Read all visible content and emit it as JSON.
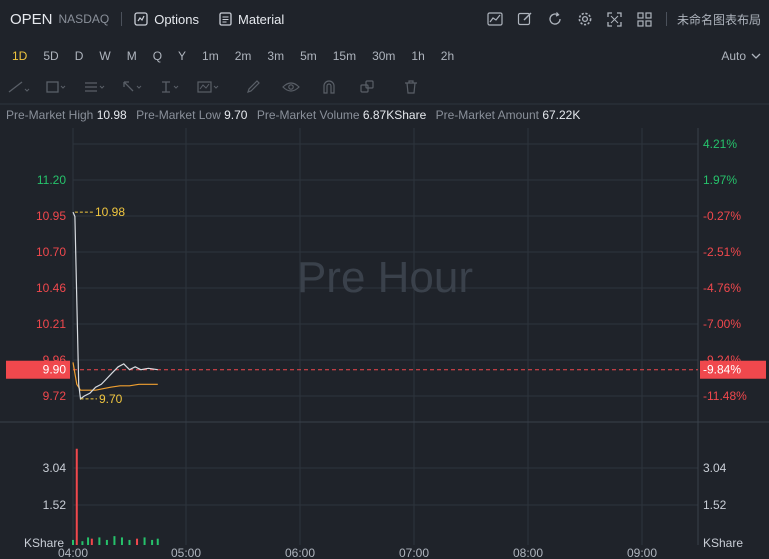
{
  "header": {
    "symbol": "OPEN",
    "exchange": "NASDAQ",
    "options_label": "Options",
    "material_label": "Material",
    "layout_name": "未命名图表布局"
  },
  "intervals": {
    "items": [
      "1D",
      "5D",
      "D",
      "W",
      "M",
      "Q",
      "Y",
      "1m",
      "2m",
      "3m",
      "5m",
      "15m",
      "30m",
      "1h",
      "2h"
    ],
    "active": "1D",
    "scale_mode": "Auto"
  },
  "info": {
    "high_label": "Pre-Market High",
    "high_value": "10.98",
    "low_label": "Pre-Market Low",
    "low_value": "9.70",
    "volume_label": "Pre-Market Volume",
    "volume_value": "6.87KShare",
    "amount_label": "Pre-Market Amount",
    "amount_value": "67.22K"
  },
  "colors": {
    "up": "#26c26b",
    "down": "#f0484d",
    "accent": "#f0c63f",
    "price_line": "#f0484d",
    "avg_line": "#f0a030"
  },
  "chart_data": {
    "type": "line",
    "watermark": "Pre Hour",
    "x_labels": [
      "04:00",
      "05:00",
      "06:00",
      "07:00",
      "08:00",
      "09:00"
    ],
    "price_axis_left": [
      "11.20",
      "10.95",
      "10.70",
      "10.46",
      "10.21",
      "9.96",
      "9.72"
    ],
    "pct_axis_right": [
      "4.21%",
      "1.97%",
      "-0.27%",
      "-2.51%",
      "-4.76%",
      "-7.00%",
      "-9.24%",
      "-11.48%"
    ],
    "current_price": "9.90",
    "current_pct": "-9.84%",
    "high_marker": "10.98",
    "low_marker": "9.70",
    "volume_axis_left": [
      "3.04",
      "1.52",
      "KShare"
    ],
    "volume_axis_right": [
      "3.04",
      "1.52",
      "KShare"
    ],
    "ylim": [
      9.6,
      11.4
    ],
    "price_series": [
      [
        0,
        10.98
      ],
      [
        1,
        10.95
      ],
      [
        3,
        9.8
      ],
      [
        4,
        9.7
      ],
      [
        6,
        9.72
      ],
      [
        9,
        9.74
      ],
      [
        12,
        9.78
      ],
      [
        15,
        9.8
      ],
      [
        18,
        9.84
      ],
      [
        21,
        9.88
      ],
      [
        24,
        9.92
      ],
      [
        27,
        9.94
      ],
      [
        30,
        9.9
      ],
      [
        33,
        9.92
      ],
      [
        36,
        9.9
      ],
      [
        40,
        9.91
      ],
      [
        45,
        9.9
      ]
    ],
    "avg_series": [
      [
        0,
        9.95
      ],
      [
        2,
        9.8
      ],
      [
        4,
        9.76
      ],
      [
        8,
        9.76
      ],
      [
        12,
        9.76
      ],
      [
        16,
        9.77
      ],
      [
        20,
        9.78
      ],
      [
        25,
        9.79
      ],
      [
        30,
        9.79
      ],
      [
        35,
        9.8
      ],
      [
        40,
        9.8
      ],
      [
        45,
        9.8
      ]
    ],
    "volume_series": [
      [
        0,
        0.2,
        "up"
      ],
      [
        2,
        3.8,
        "down"
      ],
      [
        5,
        0.15,
        "up"
      ],
      [
        8,
        0.3,
        "up"
      ],
      [
        10,
        0.25,
        "down"
      ],
      [
        14,
        0.3,
        "up"
      ],
      [
        18,
        0.2,
        "up"
      ],
      [
        22,
        0.35,
        "up"
      ],
      [
        26,
        0.3,
        "up"
      ],
      [
        30,
        0.2,
        "up"
      ],
      [
        34,
        0.25,
        "down"
      ],
      [
        38,
        0.3,
        "up"
      ],
      [
        42,
        0.2,
        "up"
      ],
      [
        45,
        0.25,
        "up"
      ]
    ]
  }
}
